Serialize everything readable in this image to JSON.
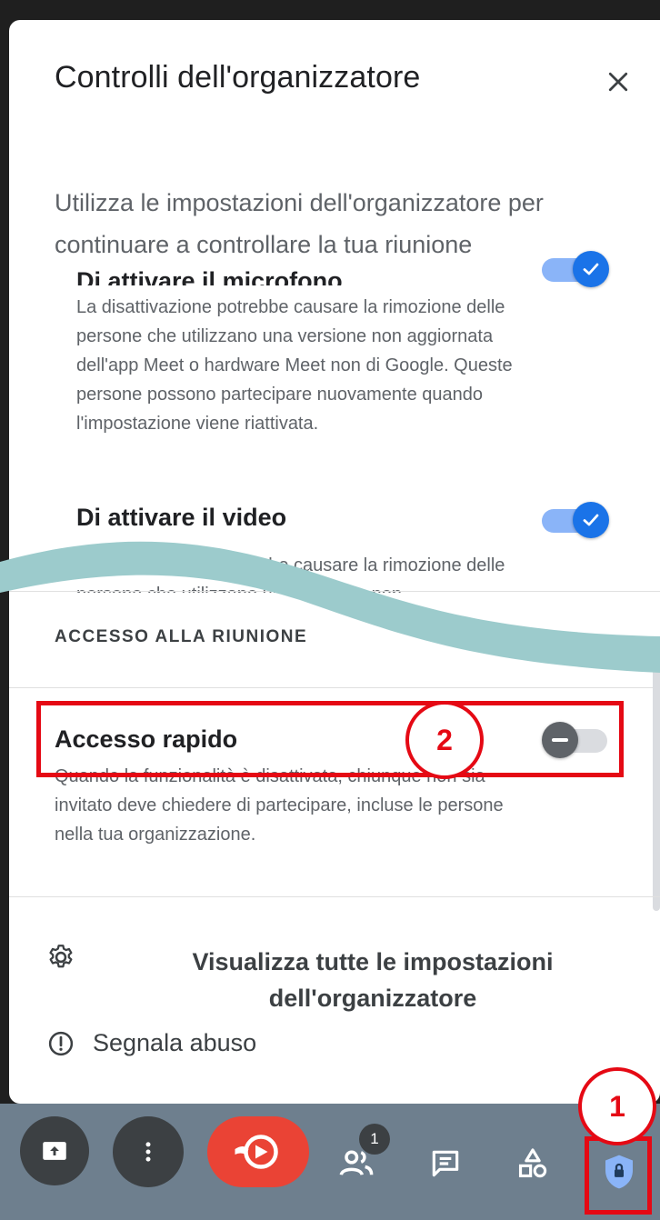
{
  "panel": {
    "title": "Controlli dell'organizzatore",
    "subtitle": "Utilizza le impostazioni dell'organizzatore per continuare a controllare la tua riunione"
  },
  "settings": [
    {
      "title": "Di attivare il microfono",
      "description": "La disattivazione potrebbe causare la rimozione delle persone che utilizzano una versione non aggiornata dell'app Meet o hardware Meet non di Google. Queste persone possono partecipare nuovamente quando l'impostazione viene riattivata.",
      "enabled": true
    },
    {
      "title": "Di attivare il video",
      "description": "La disattivazione potrebbe causare la rimozione delle persone che utilizzano una versione non",
      "enabled": true
    }
  ],
  "meeting_access": {
    "section_label": "ACCESSO ALLA RIUNIONE",
    "quick_access": {
      "title": "Accesso rapido",
      "description": "Quando la funzionalità è disattivata, chiunque non sia invitato deve chiedere di partecipare, incluse le persone nella tua organizzazione.",
      "enabled": false
    }
  },
  "footer": {
    "view_all_settings": "Visualizza tutte le impostazioni dell'organizzatore",
    "report_abuse": "Segnala abuso"
  },
  "bottom_bar": {
    "participants_count": "1"
  },
  "annotations": {
    "step1": "1",
    "step2": "2"
  },
  "colors": {
    "accent_blue": "#1a73e8",
    "hangup_red": "#ea4335",
    "highlight_red": "#e50914",
    "wave_teal": "#9ccbcc"
  }
}
